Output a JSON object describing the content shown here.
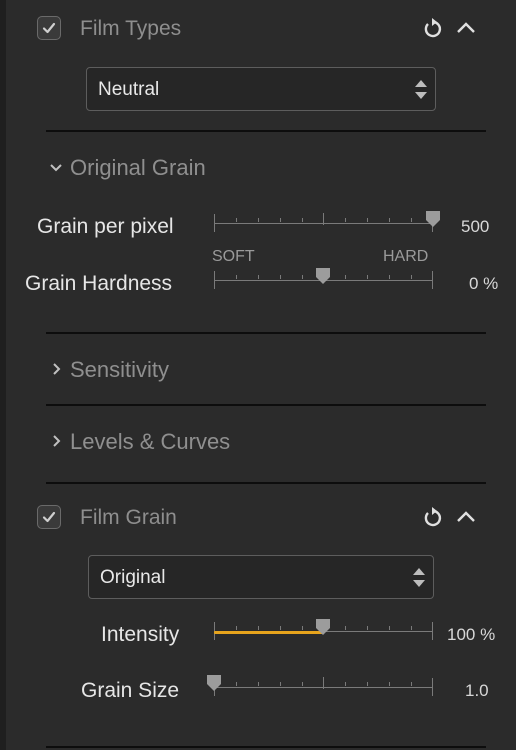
{
  "film_types": {
    "title": "Film Types",
    "enabled": true,
    "preset_value": "Neutral",
    "original_grain": {
      "title": "Original Grain",
      "grain_per_pixel": {
        "label": "Grain per pixel",
        "value_text": "500",
        "position": 1.0
      },
      "grain_hardness": {
        "label": "Grain Hardness",
        "soft_label": "SOFT",
        "hard_label": "HARD",
        "value_text": "0 %",
        "position": 0.5
      }
    },
    "sensitivity": {
      "title": "Sensitivity"
    },
    "levels_curves": {
      "title": "Levels & Curves"
    }
  },
  "film_grain": {
    "title": "Film Grain",
    "enabled": true,
    "preset_value": "Original",
    "intensity": {
      "label": "Intensity",
      "value_text": "100 %",
      "position": 0.5
    },
    "grain_size": {
      "label": "Grain Size",
      "value_text": "1.0",
      "position": 0.0
    }
  },
  "colors": {
    "accent": "#e7a41d"
  }
}
